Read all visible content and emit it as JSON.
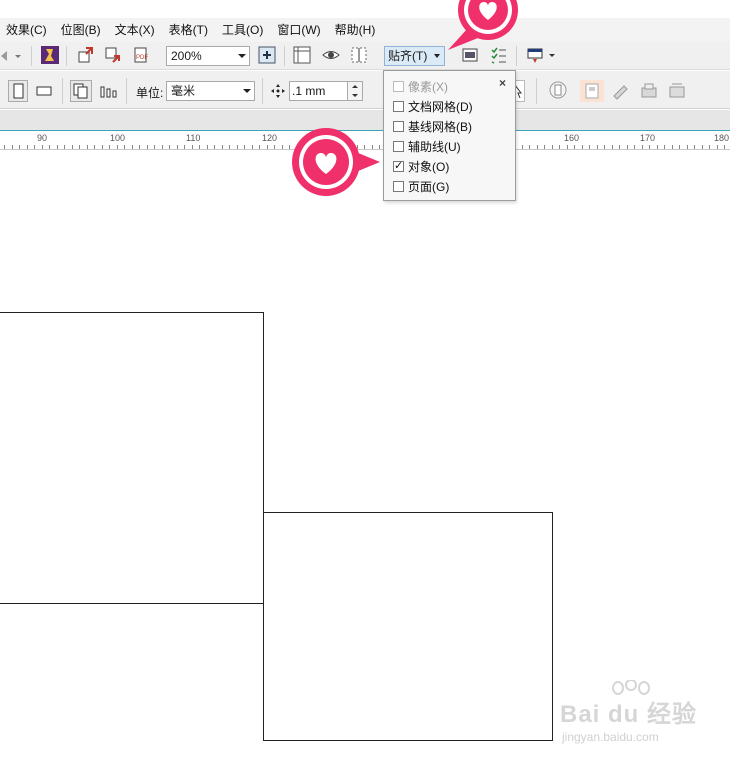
{
  "menu": {
    "items": [
      "效果(C)",
      "位图(B)",
      "文本(X)",
      "表格(T)",
      "工具(O)",
      "窗口(W)",
      "帮助(H)"
    ]
  },
  "toolbar1": {
    "zoom": "200%",
    "snap_label": "贴齐(T)"
  },
  "toolbar2": {
    "unit_label": "单位:",
    "unit_value": "毫米",
    "nudge_value": ".1 mm"
  },
  "ruler": {
    "labels": [
      "90",
      "100",
      "110",
      "120",
      "160",
      "170",
      "180"
    ]
  },
  "snap_menu": {
    "items": [
      {
        "label": "像素(X)",
        "checked": false,
        "disabled": true
      },
      {
        "label": "文档网格(D)",
        "checked": false,
        "disabled": false
      },
      {
        "label": "基线网格(B)",
        "checked": false,
        "disabled": false
      },
      {
        "label": "辅助线(U)",
        "checked": false,
        "disabled": false
      },
      {
        "label": "对象(O)",
        "checked": true,
        "disabled": false
      },
      {
        "label": "页面(G)",
        "checked": false,
        "disabled": false
      }
    ],
    "close": "×"
  },
  "watermark": {
    "brand": "Bai du 经验",
    "site": "jingyan.baidu.com"
  },
  "colors": {
    "marker": "#f0306b",
    "ruler_line": "#3aa6b9"
  }
}
